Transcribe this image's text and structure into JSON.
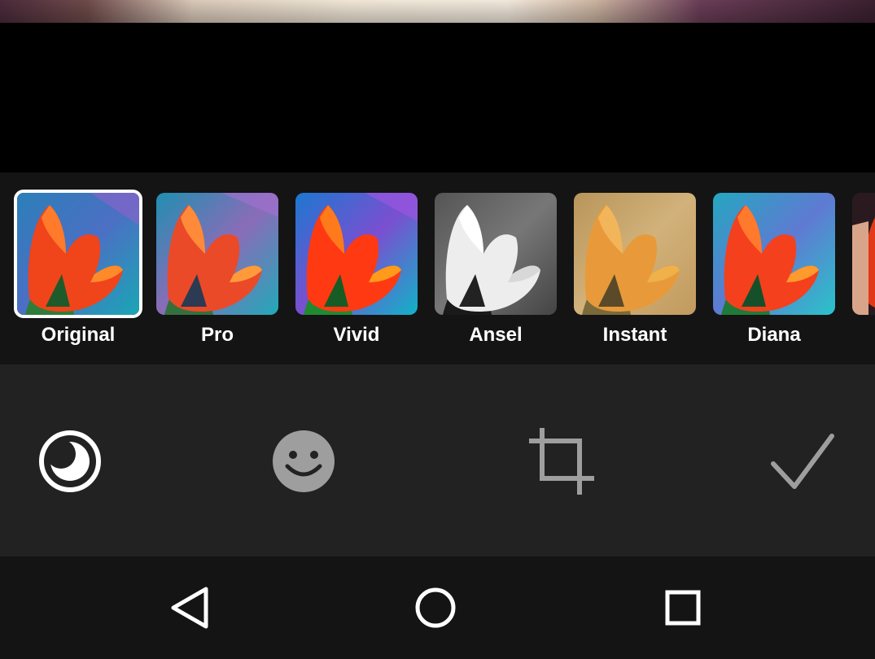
{
  "filters": [
    {
      "label": "Original",
      "selected": true
    },
    {
      "label": "Pro",
      "selected": false
    },
    {
      "label": "Vivid",
      "selected": false
    },
    {
      "label": "Ansel",
      "selected": false
    },
    {
      "label": "Instant",
      "selected": false
    },
    {
      "label": "Diana",
      "selected": false
    }
  ],
  "tools": {
    "vignette": "vignette-icon",
    "stickers": "smiley-face-icon",
    "crop": "crop-icon",
    "confirm": "checkmark-icon"
  },
  "nav": {
    "back": "back-triangle-icon",
    "home": "home-circle-icon",
    "recents": "recents-square-icon"
  },
  "colors": {
    "filter_bar_bg": "#141414",
    "tool_bar_bg": "#222222",
    "nav_bar_bg": "#141414",
    "active_tool": "#ffffff",
    "inactive_tool": "#9e9e9e"
  }
}
